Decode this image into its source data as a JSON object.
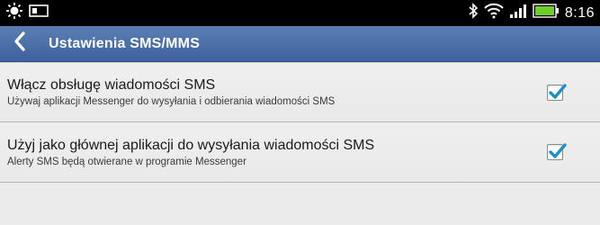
{
  "status_bar": {
    "time": "8:16",
    "icons_left": [
      "brightness-icon",
      "screen-icon"
    ],
    "icons_right": [
      "bluetooth-icon",
      "wifi-icon",
      "signal-icon",
      "battery-icon"
    ]
  },
  "action_bar": {
    "title": "Ustawienia SMS/MMS",
    "back_icon": "chevron-left-icon",
    "color": "#4a6ea6"
  },
  "settings": [
    {
      "title": "Włącz obsługę wiadomości SMS",
      "subtitle": "Używaj aplikacji Messenger do wysyłania i odbierania wiadomości SMS",
      "checked": true
    },
    {
      "title": "Użyj jako głównej aplikacji do wysyłania wiadomości SMS",
      "subtitle": "Alerty SMS będą otwierane w programie Messenger",
      "checked": true
    }
  ],
  "accent_color": "#1e90c8"
}
